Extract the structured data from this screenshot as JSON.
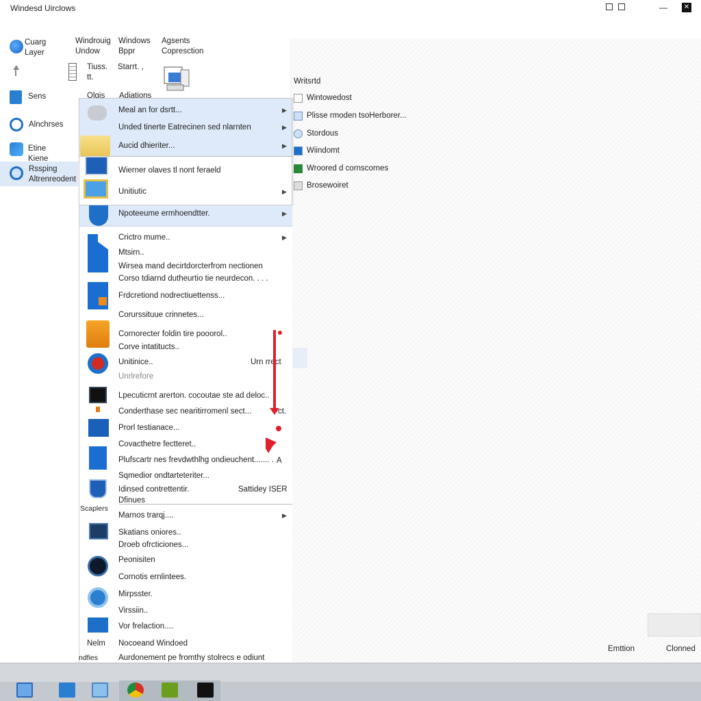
{
  "window": {
    "title": "Windesd Uirclows",
    "btn_max": "◻",
    "btn_min": "—",
    "btn_close": "✕"
  },
  "sidebar": {
    "items": [
      {
        "label": "Cuarg Layer"
      },
      {
        "label": ""
      },
      {
        "label": "Sens"
      },
      {
        "label": "Alnchrses"
      },
      {
        "label": "Etine Kiene"
      },
      {
        "label": "Rssping Altrenreodent"
      }
    ]
  },
  "columns": [
    {
      "label": "Windrouig Undow",
      "sub": "Tiuss. tt."
    },
    {
      "label": "Windows Bppr",
      "sub": "Starrt. ,"
    },
    {
      "label": "Agsents Copresction",
      "sub": ""
    }
  ],
  "column_row2": {
    "left": "Olgis",
    "right": "Adiations"
  },
  "right_panel": {
    "header": "Writsrtd",
    "items": [
      {
        "label": "Wintowedost"
      },
      {
        "label": "Plisse rmoden tsoHerborer..."
      },
      {
        "label": "Stordous"
      },
      {
        "label": "Wiindomt"
      },
      {
        "label": "Wroored d cornscornes"
      },
      {
        "label": "Brosewoiret"
      }
    ]
  },
  "context_menu_top": {
    "items": [
      {
        "label": "Meal an for dsrtt...",
        "arrow": "▶"
      },
      {
        "label": "Unded tinerte Eatrecinen sed nlarnten",
        "arrow": "▶"
      },
      {
        "label": "Aucid dhieriter...",
        "arrow": "▶"
      },
      {
        "label": "Wierner olaves tl nont feraeld",
        "arrow": ""
      },
      {
        "label": "Unitiutic",
        "arrow": "▶"
      }
    ]
  },
  "context_menu_main": {
    "items": [
      {
        "label": "Npoteeume ermhoendtter.",
        "arrow": "▶"
      },
      {
        "label": "Crictro mume..",
        "arrow": "▶"
      },
      {
        "label": "Mtsirn..",
        "arrow": ""
      },
      {
        "label": "Wirsea mand decirtdorcterfrom nectionen",
        "arrow": ""
      },
      {
        "label": "Corso tdiarnd dutheurtio tie neurdecon. . . .",
        "arrow": ""
      },
      {
        "label": "Frdcretiond nodrectiuettenss...",
        "arrow": ""
      },
      {
        "label": "Corurssituue crinnetes...",
        "arrow": ""
      },
      {
        "label": "Cornorecter foldin tire pooorol..",
        "arrow": ""
      },
      {
        "label": "Corve intatitucts..",
        "arrow": ""
      },
      {
        "label": "Unitinice..",
        "arrow": "",
        "right": "Urn rrect"
      },
      {
        "label": "Unrlrefore",
        "arrow": ""
      },
      {
        "label": "Lpecuticrnt arerton. cocoutae ste ad deloc..",
        "arrow": ""
      },
      {
        "label": "Conderthase sec nearitirromenl sect...",
        "arrow": "",
        "right": "ct."
      },
      {
        "label": "Prorl testianace...",
        "arrow": ""
      },
      {
        "label": "Covacthetre fectteret..",
        "arrow": ""
      },
      {
        "label": "Plufscartr nes frevdwthlhg ondieuchent....... .",
        "arrow": "",
        "right": "A"
      },
      {
        "label": "Sqmedior ondtarteteriter...",
        "arrow": ""
      },
      {
        "label": "Idinsed contrettentir.",
        "arrow": "",
        "right": "Sattidey ISER"
      },
      {
        "label": "Dfinues",
        "arrow": ""
      },
      {
        "label": "Marnos trarqj....",
        "arrow": "▶"
      },
      {
        "label": "Skatians oniores..",
        "arrow": ""
      },
      {
        "label": "Droeb ofrcticiones...",
        "arrow": ""
      },
      {
        "label": "Peonisiten",
        "arrow": ""
      },
      {
        "label": "Cornotis ernlintees.",
        "arrow": ""
      },
      {
        "label": "Mirpsster.",
        "arrow": ""
      },
      {
        "label": "Virssiin..",
        "arrow": ""
      },
      {
        "label": "Vor frelaction....",
        "arrow": ""
      },
      {
        "label": "Nocoeand Windoed",
        "arrow": ""
      },
      {
        "label": "Aurdonement pe fromthy stolrecs e odiunt",
        "arrow": ""
      }
    ],
    "left_labels": [
      {
        "label": "Scaplers"
      },
      {
        "label": "Nelm"
      },
      {
        "label": "ndfies"
      }
    ]
  },
  "bottom": {
    "left": "Emttion",
    "right": "Clonned"
  },
  "colors": {
    "menu_highlight": "#deeaf9",
    "accent_red": "#e0202a",
    "win_blue": "#1e6fc8"
  }
}
